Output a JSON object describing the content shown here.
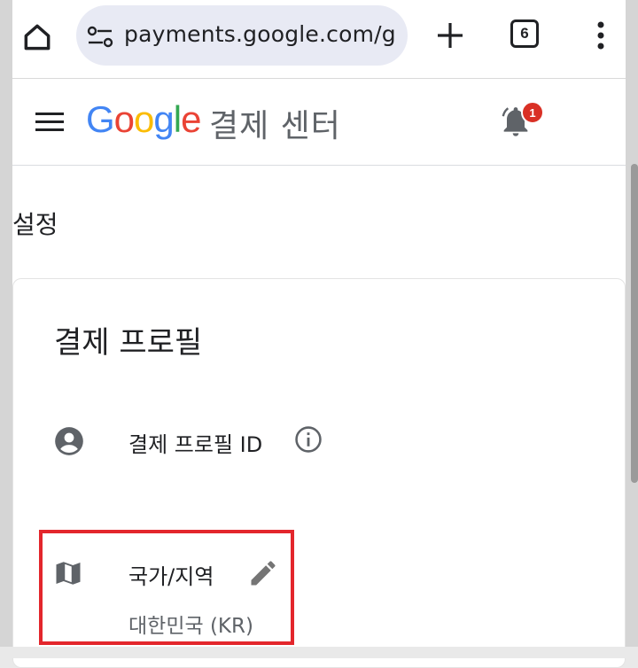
{
  "browser": {
    "url": "payments.google.com/g",
    "tab_count": "6",
    "icons": {
      "home": "home-icon",
      "site_settings": "site-settings-icon",
      "new_tab": "plus-icon",
      "menu": "more-vert-icon"
    }
  },
  "header": {
    "logo_letters": [
      "G",
      "o",
      "o",
      "g",
      "l",
      "e"
    ],
    "logo_colors": [
      "#4285F4",
      "#EA4335",
      "#FBBC05",
      "#4285F4",
      "#34A853",
      "#EA4335"
    ],
    "product_name": "결제 센터",
    "notification_count": "1"
  },
  "page": {
    "title": "설정"
  },
  "card": {
    "title": "결제 프로필",
    "profile_id_label": "결제 프로필 ID",
    "country_label": "국가/지역",
    "country_value": "대한민국 (KR)"
  },
  "colors": {
    "highlight": "#e3262c",
    "icon_gray": "#5f6368",
    "badge": "#d93025"
  }
}
